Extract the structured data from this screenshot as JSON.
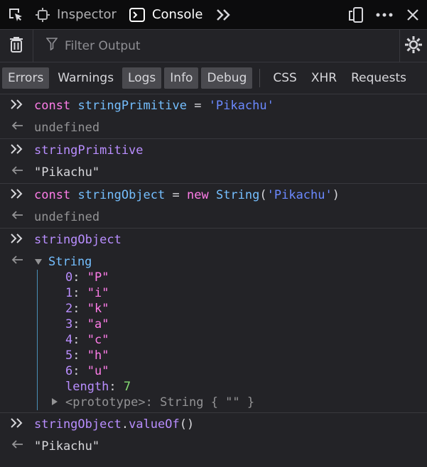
{
  "toolbar": {
    "tabs": [
      {
        "label": "Inspector",
        "icon": "inspector-icon"
      },
      {
        "label": "Console",
        "icon": "console-icon"
      }
    ]
  },
  "filter": {
    "placeholder": "Filter Output"
  },
  "levels": [
    {
      "label": "Errors",
      "on": true
    },
    {
      "label": "Warnings",
      "on": false
    },
    {
      "label": "Logs",
      "on": true
    },
    {
      "label": "Info",
      "on": true
    },
    {
      "label": "Debug",
      "on": true
    }
  ],
  "categories": [
    "CSS",
    "XHR",
    "Requests"
  ],
  "console": {
    "in1": {
      "kw": "const",
      "name": "stringPrimitive",
      "eq": " = ",
      "value": "'Pikachu'"
    },
    "out1": "undefined",
    "in2": "stringPrimitive",
    "out2": "\"Pikachu\"",
    "in3": {
      "kw": "const",
      "name": "stringObject",
      "eq": " = ",
      "new": "new",
      "ctor": "String",
      "paren_open": "(",
      "value": "'Pikachu'",
      "paren_close": ")"
    },
    "out3": "undefined",
    "in4": "stringObject",
    "out4": {
      "type": "String",
      "entries": [
        {
          "key": "0",
          "value": "\"P\""
        },
        {
          "key": "1",
          "value": "\"i\""
        },
        {
          "key": "2",
          "value": "\"k\""
        },
        {
          "key": "3",
          "value": "\"a\""
        },
        {
          "key": "4",
          "value": "\"c\""
        },
        {
          "key": "5",
          "value": "\"h\""
        },
        {
          "key": "6",
          "value": "\"u\""
        }
      ],
      "length_key": "length",
      "length_value": "7",
      "prototype": "<prototype>",
      "prototype_value": ": String { \"\" }"
    },
    "in5": {
      "obj": "stringObject",
      "dot": ".",
      "method": "valueOf",
      "call": "()"
    },
    "out5": "\"Pikachu\""
  }
}
